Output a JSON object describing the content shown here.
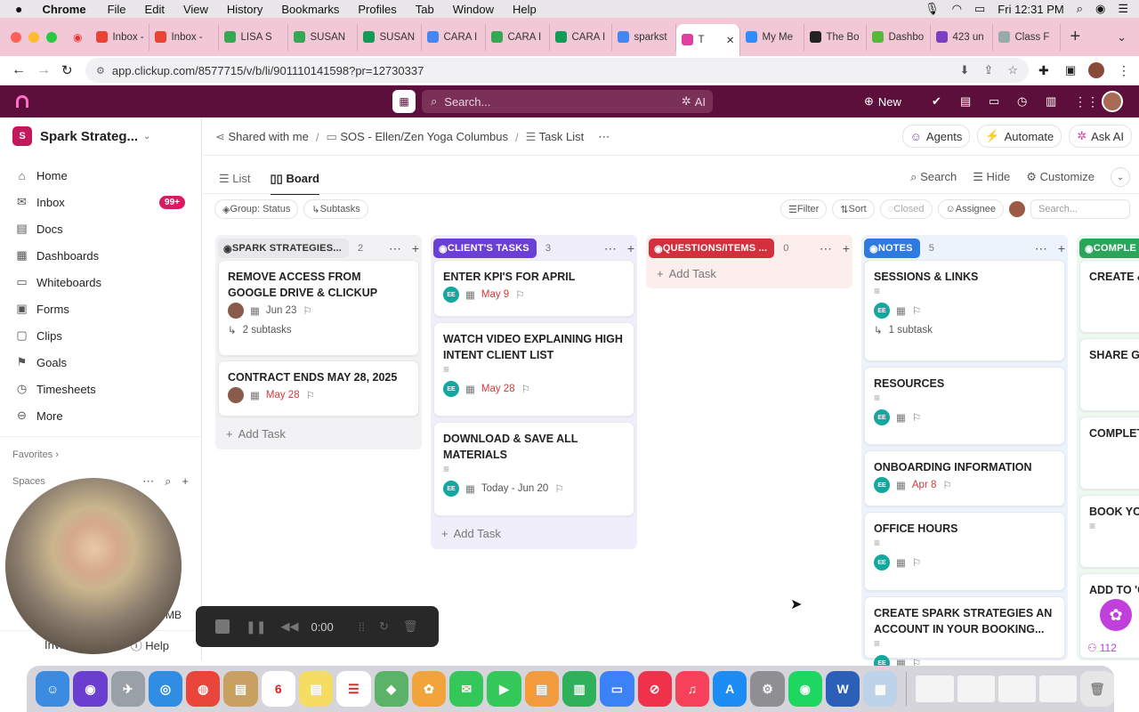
{
  "menubar": {
    "app": "Chrome",
    "items": [
      "File",
      "Edit",
      "View",
      "History",
      "Bookmarks",
      "Profiles",
      "Tab",
      "Window",
      "Help"
    ],
    "clock": "Fri 12:31 PM"
  },
  "tabs": [
    {
      "label": "Inbox -",
      "color": "#ea4335",
      "icon": "gmail-icon"
    },
    {
      "label": "Inbox -",
      "color": "#ea4335",
      "icon": "gmail-icon"
    },
    {
      "label": "LISA S",
      "color": "#34a853",
      "icon": "drive-icon"
    },
    {
      "label": "SUSAN",
      "color": "#34a853",
      "icon": "drive-icon"
    },
    {
      "label": "SUSAN",
      "color": "#0f9d58",
      "icon": "sheets-icon"
    },
    {
      "label": "CARA I",
      "color": "#4285f4",
      "icon": "docs-icon"
    },
    {
      "label": "CARA I",
      "color": "#34a853",
      "icon": "drive-icon"
    },
    {
      "label": "CARA I",
      "color": "#0f9d58",
      "icon": "sheets-icon"
    },
    {
      "label": "sparkst",
      "color": "#4285f4",
      "icon": "google-icon"
    },
    {
      "label": "T",
      "color": "#e040a0",
      "icon": "clickup-icon",
      "active": true
    },
    {
      "label": "My Me",
      "color": "#2d8cff",
      "icon": "zoom-icon"
    },
    {
      "label": "The Bo",
      "color": "#222222",
      "icon": "de-icon"
    },
    {
      "label": "Dashbo",
      "color": "#57b93a",
      "icon": "dashboard-icon"
    },
    {
      "label": "423 un",
      "color": "#7b3fc4",
      "icon": "mail-icon"
    },
    {
      "label": "Class F",
      "color": "#9aa",
      "icon": "class-icon"
    }
  ],
  "address": {
    "url": "app.clickup.com/8577715/v/b/li/901110141598?pr=12730337"
  },
  "cu_top": {
    "search_placeholder": "Search...",
    "ai_label": "AI",
    "new_label": "New"
  },
  "sidebar": {
    "workspace": "Spark Strateg...",
    "workspace_initial": "S",
    "items": [
      {
        "label": "Home",
        "icon": "home-icon"
      },
      {
        "label": "Inbox",
        "icon": "inbox-icon",
        "badge": "99+"
      },
      {
        "label": "Docs",
        "icon": "docs-icon"
      },
      {
        "label": "Dashboards",
        "icon": "dashboards-icon"
      },
      {
        "label": "Whiteboards",
        "icon": "whiteboard-icon"
      },
      {
        "label": "Forms",
        "icon": "forms-icon"
      },
      {
        "label": "Clips",
        "icon": "clips-icon"
      },
      {
        "label": "Goals",
        "icon": "goals-icon"
      },
      {
        "label": "Timesheets",
        "icon": "timesheets-icon"
      },
      {
        "label": "More",
        "icon": "more-icon"
      }
    ],
    "favorites": "Favorites",
    "spaces": "Spaces",
    "invite": "Invite",
    "help": "Help",
    "user_tail": "a MB"
  },
  "breadcrumb": {
    "shared": "Shared with me",
    "folder": "SOS - Ellen/Zen Yoga Columbus",
    "list": "Task List"
  },
  "header_actions": {
    "agents": "Agents",
    "automate": "Automate",
    "ask_ai": "Ask AI"
  },
  "views": {
    "list": "List",
    "board": "Board",
    "search": "Search",
    "hide": "Hide",
    "customize": "Customize"
  },
  "filters": {
    "group": "Group: Status",
    "subtasks": "Subtasks",
    "filter": "Filter",
    "sort": "Sort",
    "closed": "Closed",
    "assignee": "Assignee",
    "search_placeholder": "Search..."
  },
  "columns": [
    {
      "name": "SPARK STRATEGIES...",
      "count": "2",
      "color": "#e8e8ea",
      "text": "#333333",
      "cards": [
        {
          "title": "REMOVE ACCESS FROM GOOGLE DRIVE & CLICKUP",
          "date": "Jun 23",
          "date_red": false,
          "subtasks": "2 subtasks"
        },
        {
          "title": "CONTRACT ENDS MAY 28, 2025",
          "date": "May 28",
          "date_red": true
        }
      ],
      "add": "Add Task"
    },
    {
      "name": "CLIENT'S TASKS",
      "count": "3",
      "color": "#6b3fd6",
      "text": "#ffffff",
      "cards": [
        {
          "title": "ENTER KPI'S FOR APRIL",
          "date": "May 9",
          "date_red": true
        },
        {
          "title": "WATCH VIDEO EXPLAINING HIGH INTENT CLIENT LIST",
          "date": "May 28",
          "date_red": true
        },
        {
          "title": "DOWNLOAD & SAVE ALL MATERIALS",
          "date": "Today - Jun 20",
          "date_red": false
        }
      ],
      "add": "Add Task"
    },
    {
      "name": "QUESTIONS/ITEMS ...",
      "count": "0",
      "color": "#d32f3c",
      "text": "#ffffff",
      "cards": [],
      "add": "Add Task"
    },
    {
      "name": "NOTES",
      "count": "5",
      "color": "#2d7be0",
      "text": "#ffffff",
      "cards": [
        {
          "title": "SESSIONS & LINKS",
          "subtasks": "1 subtask"
        },
        {
          "title": "RESOURCES"
        },
        {
          "title": "ONBOARDING INFORMATION",
          "date": "Apr 8",
          "date_red": true
        },
        {
          "title": "OFFICE HOURS"
        },
        {
          "title": "CREATE SPARK STRATEGIES AN ACCOUNT IN YOUR BOOKING..."
        }
      ]
    },
    {
      "name": "COMPLE",
      "color": "#2aa65a",
      "text": "#ffffff",
      "cards": [
        {
          "title": "CREATE & PACKET T"
        },
        {
          "title": "SHARE GO WITH CLI"
        },
        {
          "title": "COMPLET PRIOR TO"
        },
        {
          "title": "BOOK YO"
        },
        {
          "title": "ADD TO 'C EN TE"
        }
      ]
    }
  ],
  "recorder": {
    "time": "0:00"
  },
  "people_count": "112",
  "assignee_initials": "EE",
  "dock_calendar": {
    "month": "JUN",
    "day": "6"
  }
}
